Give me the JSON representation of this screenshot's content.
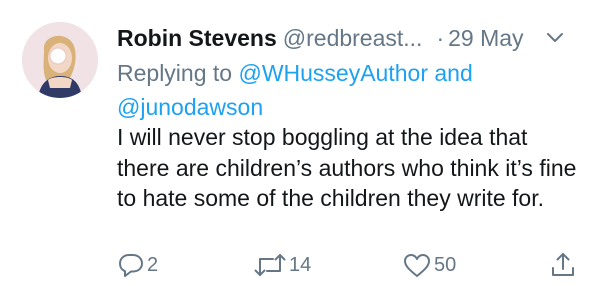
{
  "tweet": {
    "author_name": "Robin Stevens",
    "author_handle": "@redbreast...",
    "separator": "·",
    "date": "29 May",
    "replying_prefix": "Replying to",
    "reply_mention_1": "@WHusseyAuthor",
    "reply_and": "and",
    "reply_mention_2": "@junodawson",
    "text": "I will never stop boggling at the idea that there are children’s authors who think it’s fine to hate some of the children they write for."
  },
  "actions": {
    "replies": "2",
    "retweets": "14",
    "likes": "50"
  },
  "icons": {
    "menu": "chevron-down-icon",
    "reply": "reply-icon",
    "retweet": "retweet-icon",
    "like": "heart-icon",
    "share": "share-icon"
  },
  "colors": {
    "link": "#1da1f2",
    "secondary": "#657786",
    "text": "#14171a"
  }
}
